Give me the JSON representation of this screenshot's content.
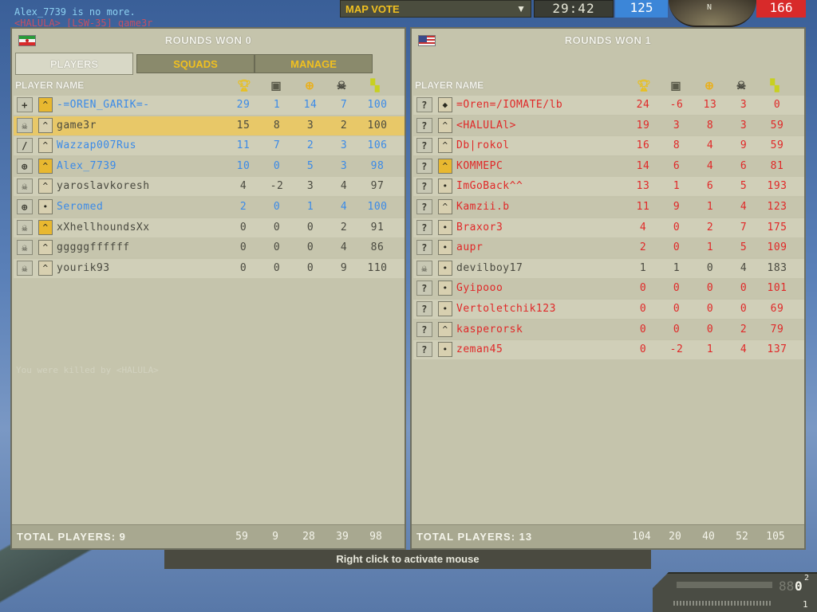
{
  "kill_feed": [
    "Alex_7739 is no more.",
    "<HALULA> [LSW-35] game3r"
  ],
  "hud": {
    "map_vote_label": "MAP VOTE",
    "timer": "29:42",
    "ticket_blue": "125",
    "ticket_red": "166",
    "compass_letter": "N",
    "ammo_mag": "88",
    "ammo_count": "0",
    "ammo_sup": "2",
    "ammo_grenades": "1"
  },
  "messages": {
    "killed_by": "You were killed by <HALULA>",
    "activate_mouse": "Right click to activate mouse"
  },
  "left_team": {
    "flag": "iran-flag",
    "rounds_won": "ROUNDS WON 0",
    "tabs": [
      "PLAYERS",
      "SQUADS",
      "MANAGE"
    ],
    "column_header": "PLAYER NAME",
    "players": [
      {
        "kit": "+",
        "rank": "^",
        "name": "-=OREN_GARIK=-",
        "score": "29",
        "deaths_team": "1",
        "kills": "14",
        "deaths": "7",
        "ping": "100",
        "color": "blue"
      },
      {
        "kit": "☠",
        "rank": "^",
        "name": "game3r",
        "score": "15",
        "deaths_team": "8",
        "kills": "3",
        "deaths": "2",
        "ping": "100",
        "color": "dark"
      },
      {
        "kit": "/",
        "rank": "^",
        "name": "Wazzap007Rus",
        "score": "11",
        "deaths_team": "7",
        "kills": "2",
        "deaths": "3",
        "ping": "106",
        "color": "blue"
      },
      {
        "kit": "⊕",
        "rank": "^",
        "name": "Alex_7739",
        "score": "10",
        "deaths_team": "0",
        "kills": "5",
        "deaths": "3",
        "ping": "98",
        "color": "blue"
      },
      {
        "kit": "☠",
        "rank": "^",
        "name": "yaroslavkoresh",
        "score": "4",
        "deaths_team": "-2",
        "kills": "3",
        "deaths": "4",
        "ping": "97",
        "color": "dark"
      },
      {
        "kit": "⊕",
        "rank": "•",
        "name": "Seromed",
        "score": "2",
        "deaths_team": "0",
        "kills": "1",
        "deaths": "4",
        "ping": "100",
        "color": "blue"
      },
      {
        "kit": "☠",
        "rank": "^",
        "name": "xXhellhoundsXx",
        "score": "0",
        "deaths_team": "0",
        "kills": "0",
        "deaths": "2",
        "ping": "91",
        "color": "dark"
      },
      {
        "kit": "☠",
        "rank": "^",
        "name": "gggggffffff",
        "score": "0",
        "deaths_team": "0",
        "kills": "0",
        "deaths": "4",
        "ping": "86",
        "color": "dark"
      },
      {
        "kit": "☠",
        "rank": "^",
        "name": "yourik93",
        "score": "0",
        "deaths_team": "0",
        "kills": "0",
        "deaths": "9",
        "ping": "110",
        "color": "dark"
      }
    ],
    "footer": {
      "label": "TOTAL PLAYERS: 9",
      "score": "59",
      "deaths_team": "9",
      "kills": "28",
      "deaths": "39",
      "ping": "98"
    }
  },
  "right_team": {
    "flag": "usa-flag",
    "rounds_won": "ROUNDS WON 1",
    "column_header": "PLAYER NAME",
    "players": [
      {
        "kit": "?",
        "rank": "◆",
        "name": "=Oren=/IOMATE/lb",
        "score": "24",
        "deaths_team": "-6",
        "kills": "13",
        "deaths": "3",
        "ping": "0",
        "color": "red"
      },
      {
        "kit": "?",
        "rank": "^",
        "name": "<HALULAl>",
        "score": "19",
        "deaths_team": "3",
        "kills": "8",
        "deaths": "3",
        "ping": "59",
        "color": "red"
      },
      {
        "kit": "?",
        "rank": "^",
        "name": "Db|rokol",
        "score": "16",
        "deaths_team": "8",
        "kills": "4",
        "deaths": "9",
        "ping": "59",
        "color": "red"
      },
      {
        "kit": "?",
        "rank": "^",
        "name": "KOMMEPC",
        "score": "14",
        "deaths_team": "6",
        "kills": "4",
        "deaths": "6",
        "ping": "81",
        "color": "red"
      },
      {
        "kit": "?",
        "rank": "•",
        "name": "ImGoBack^^",
        "score": "13",
        "deaths_team": "1",
        "kills": "6",
        "deaths": "5",
        "ping": "193",
        "color": "red"
      },
      {
        "kit": "?",
        "rank": "^",
        "name": "Kamzii.b",
        "score": "11",
        "deaths_team": "9",
        "kills": "1",
        "deaths": "4",
        "ping": "123",
        "color": "red"
      },
      {
        "kit": "?",
        "rank": "•",
        "name": "Braxor3",
        "score": "4",
        "deaths_team": "0",
        "kills": "2",
        "deaths": "7",
        "ping": "175",
        "color": "red"
      },
      {
        "kit": "?",
        "rank": "•",
        "name": "aupr",
        "score": "2",
        "deaths_team": "0",
        "kills": "1",
        "deaths": "5",
        "ping": "109",
        "color": "red"
      },
      {
        "kit": "☠",
        "rank": "•",
        "name": "devilboy17",
        "score": "1",
        "deaths_team": "1",
        "kills": "0",
        "deaths": "4",
        "ping": "183",
        "color": "dark"
      },
      {
        "kit": "?",
        "rank": "•",
        "name": "Gyipooo",
        "score": "0",
        "deaths_team": "0",
        "kills": "0",
        "deaths": "0",
        "ping": "101",
        "color": "red"
      },
      {
        "kit": "?",
        "rank": "•",
        "name": "Vertoletchik123",
        "score": "0",
        "deaths_team": "0",
        "kills": "0",
        "deaths": "0",
        "ping": "69",
        "color": "red"
      },
      {
        "kit": "?",
        "rank": "^",
        "name": "kasperorsk",
        "score": "0",
        "deaths_team": "0",
        "kills": "0",
        "deaths": "2",
        "ping": "79",
        "color": "red"
      },
      {
        "kit": "?",
        "rank": "•",
        "name": "zeman45",
        "score": "0",
        "deaths_team": "-2",
        "kills": "1",
        "deaths": "4",
        "ping": "137",
        "color": "red"
      }
    ],
    "footer": {
      "label": "TOTAL PLAYERS: 13",
      "score": "104",
      "deaths_team": "20",
      "kills": "40",
      "deaths": "52",
      "ping": "105"
    }
  },
  "column_icons": [
    "trophy-icon",
    "medic-icon",
    "target-icon",
    "skull-icon",
    "score-icon"
  ],
  "colors": {
    "blue_team": "#3a8ae8",
    "red_team": "#e02828",
    "self_highlight": "#e8c868"
  }
}
